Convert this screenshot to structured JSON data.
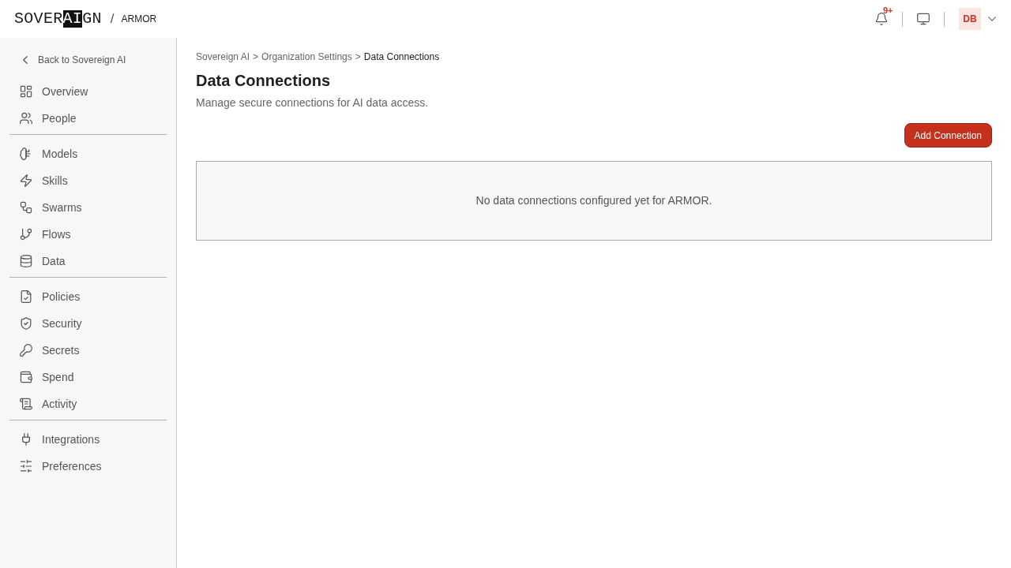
{
  "header": {
    "logo": [
      {
        "text": "SOVER",
        "inverted": false
      },
      {
        "text": "AI",
        "inverted": true
      },
      {
        "text": "GN",
        "inverted": false
      }
    ],
    "separator": "/",
    "workspace": "ARMOR",
    "notifications": {
      "badge": "9+"
    },
    "avatar": {
      "initials": "DB"
    }
  },
  "sidebar": {
    "back_link": "Back to Sovereign AI",
    "groups": [
      {
        "items": [
          {
            "label": "Overview",
            "selected": false
          },
          {
            "label": "People",
            "selected": false
          }
        ]
      },
      {
        "items": [
          {
            "label": "Models",
            "selected": false
          },
          {
            "label": "Skills",
            "selected": false
          },
          {
            "label": "Swarms",
            "selected": false
          },
          {
            "label": "Flows",
            "selected": false
          },
          {
            "label": "Data",
            "selected": false
          }
        ]
      },
      {
        "items": [
          {
            "label": "Policies",
            "selected": false
          },
          {
            "label": "Security",
            "selected": false
          },
          {
            "label": "Secrets",
            "selected": false
          },
          {
            "label": "Spend",
            "selected": false
          },
          {
            "label": "Activity",
            "selected": false
          }
        ]
      },
      {
        "items": [
          {
            "label": "Integrations",
            "selected": false
          },
          {
            "label": "Preferences",
            "selected": false
          }
        ]
      }
    ]
  },
  "breadcrumb": [
    {
      "text": "Sovereign AI",
      "kind": "link"
    },
    {
      "text": ">",
      "kind": "separator"
    },
    {
      "text": "Organization Settings",
      "kind": "link"
    },
    {
      "text": ">",
      "kind": "separator"
    },
    {
      "text": "Data Connections",
      "kind": "current"
    }
  ],
  "page": {
    "title": "Data Connections",
    "subtitle": "Manage secure connections for AI data access.",
    "primary_button": "Add Connection",
    "empty_state": "No data connections configured yet for ARMOR."
  }
}
